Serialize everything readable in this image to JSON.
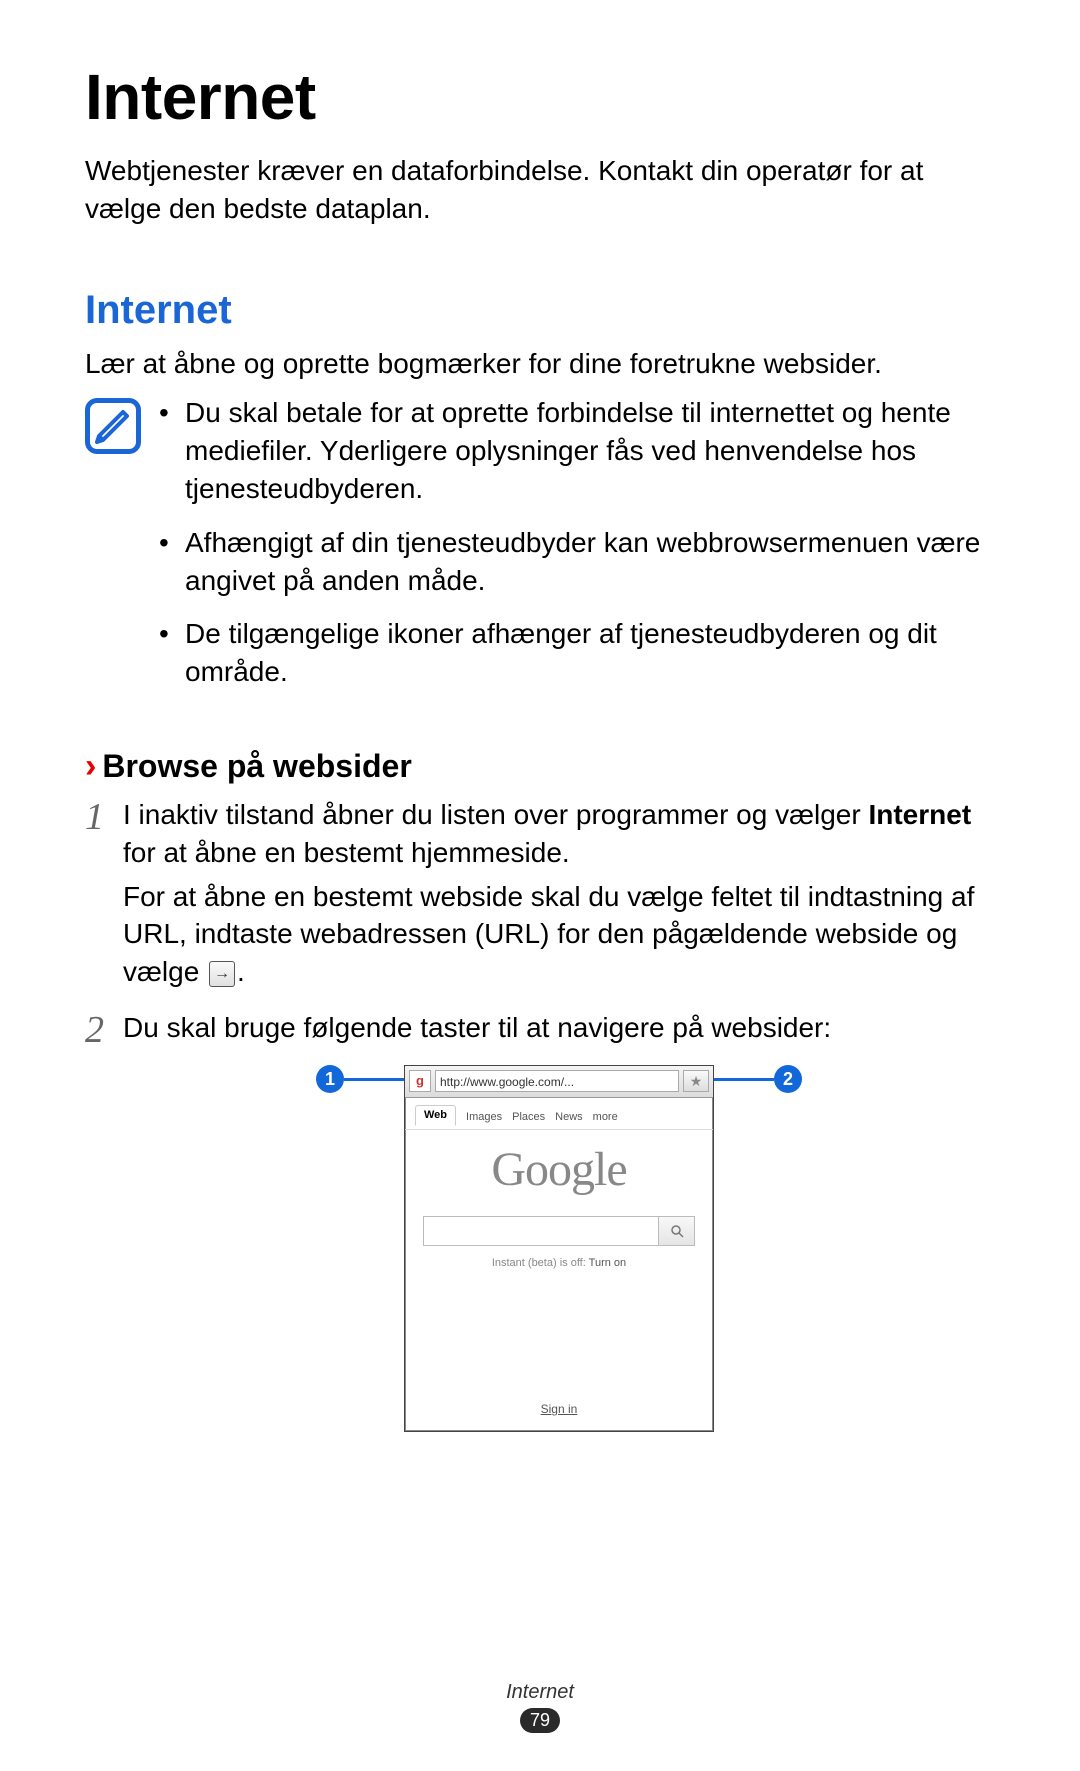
{
  "title": "Internet",
  "intro": "Webtjenester kræver en dataforbindelse. Kontakt din operatør for at vælge den bedste dataplan.",
  "section": {
    "heading": "Internet",
    "text": "Lær at åbne og oprette bogmærker for dine foretrukne websider.",
    "notes": [
      "Du skal betale for at oprette forbindelse til internettet og hente mediefiler. Yderligere oplysninger fås ved henvendelse hos tjenesteudbyderen.",
      "Afhængigt af din tjenesteudbyder kan webbrowsermenuen være angivet på anden måde.",
      "De tilgængelige ikoner afhænger af tjenesteudbyderen og dit område."
    ]
  },
  "browse": {
    "heading": "Browse på websider",
    "step1_pre": "I inaktiv tilstand åbner du listen over programmer og vælger ",
    "step1_bold": "Internet",
    "step1_post": " for at åbne en bestemt hjemmeside.",
    "step1_para2_pre": "For at åbne en bestemt webside skal du vælge feltet til indtastning af URL, indtaste webadressen (URL) for den pågældende webside og vælge ",
    "step1_para2_post": ".",
    "step2": "Du skal bruge følgende taster til at navigere på websider:"
  },
  "callouts": {
    "left": "1",
    "right": "2"
  },
  "phone": {
    "url": "http://www.google.com/...",
    "tabs": {
      "web": "Web",
      "images": "Images",
      "places": "Places",
      "news": "News",
      "more": "more"
    },
    "logo": "Google",
    "instant_label": "Instant (beta) is off: ",
    "instant_link": "Turn on",
    "signin": "Sign in"
  },
  "footer": {
    "section": "Internet",
    "page": "79"
  }
}
